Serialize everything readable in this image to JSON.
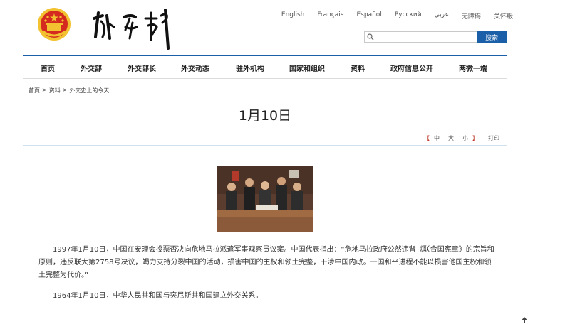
{
  "header": {
    "emblem_icon": "national-emblem-icon",
    "site_logo_text": "外交部",
    "languages": [
      "English",
      "Français",
      "Español",
      "Русский",
      "عربي",
      "无障碍",
      "关怀版"
    ],
    "search": {
      "placeholder": "",
      "button_label": "搜索",
      "icon": "search-icon"
    }
  },
  "nav": {
    "items": [
      "首页",
      "外交部",
      "外交部长",
      "外交动态",
      "驻外机构",
      "国家和组织",
      "资料",
      "政府信息公开",
      "两微一端"
    ]
  },
  "breadcrumb": [
    "首页",
    "资料",
    "外交史上的今天"
  ],
  "breadcrumb_sep": ">",
  "article": {
    "title": "1月10日",
    "tools": {
      "open": "【",
      "sizes": [
        "中",
        "大",
        "小"
      ],
      "close": "】",
      "print": "打印"
    },
    "photo_icon": "photo-un-security-council",
    "paragraphs": [
      "1997年1月10日，中国在安理会投票否决向危地马拉派遣军事观察员议案。中国代表指出：“危地马拉政府公然违背《联合国宪章》的宗旨和原则，违反联大第2758号决议，竭力支持分裂中国的活动，损害中国的主权和领土完整，干涉中国内政。一国和平进程不能以损害他国主权和领土完整为代价。”",
      "1964年1月10日，中华人民共和国与突尼斯共和国建立外交关系。"
    ]
  },
  "back_to_top_icon": "arrow-up-icon",
  "colors": {
    "accent": "#1b5fa8",
    "emblem_red": "#d42a1f",
    "emblem_gold": "#f2c230"
  }
}
